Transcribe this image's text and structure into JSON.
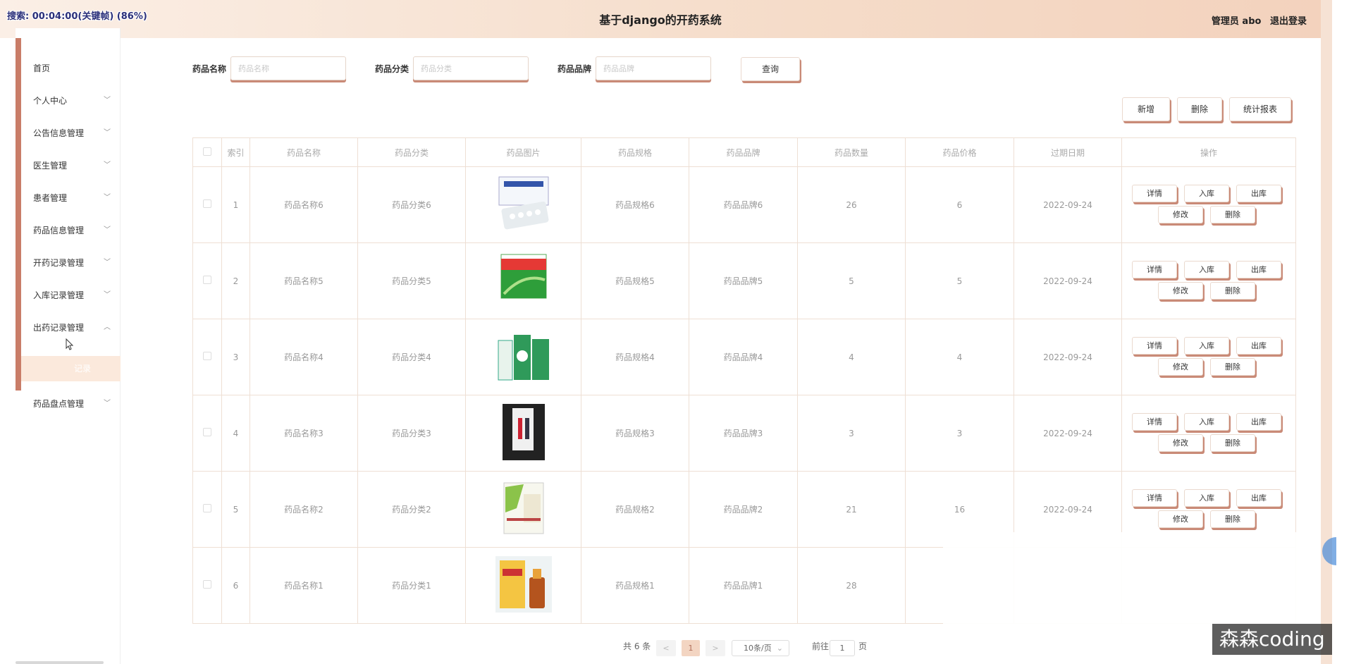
{
  "header": {
    "recording": "搜索: 00:04:00(关键帧) (86%)",
    "title": "基于django的开药系统",
    "user_label": "管理员 abo",
    "logout_label": "退出登录"
  },
  "sidebar": {
    "items": [
      {
        "label": "首页",
        "chevron": ""
      },
      {
        "label": "个人中心",
        "chevron": "﹀"
      },
      {
        "label": "公告信息管理",
        "chevron": "﹀"
      },
      {
        "label": "医生管理",
        "chevron": "﹀"
      },
      {
        "label": "患者管理",
        "chevron": "﹀"
      },
      {
        "label": "药品信息管理",
        "chevron": "﹀"
      },
      {
        "label": "开药记录管理",
        "chevron": "﹀"
      },
      {
        "label": "入库记录管理",
        "chevron": "﹀"
      },
      {
        "label": "出药记录管理",
        "chevron": "︿"
      },
      {
        "label": "药品盘点管理",
        "chevron": "﹀"
      }
    ],
    "sub_item": "记录"
  },
  "search": {
    "name_label": "药品名称",
    "name_placeholder": "药品名称",
    "category_label": "药品分类",
    "category_placeholder": "药品分类",
    "brand_label": "药品品牌",
    "brand_placeholder": "药品品牌",
    "query_button": "查询"
  },
  "actions": {
    "add": "新增",
    "delete": "删除",
    "report": "统计报表"
  },
  "table": {
    "headers": [
      "",
      "索引",
      "药品名称",
      "药品分类",
      "药品图片",
      "药品规格",
      "药品品牌",
      "药品数量",
      "药品价格",
      "过期日期",
      "操作"
    ],
    "rows": [
      {
        "index": "1",
        "name": "药品名称6",
        "category": "药品分类6",
        "spec": "药品规格6",
        "brand": "药品品牌6",
        "qty": "26",
        "price": "6",
        "expiry": "2022-09-24"
      },
      {
        "index": "2",
        "name": "药品名称5",
        "category": "药品分类5",
        "spec": "药品规格5",
        "brand": "药品品牌5",
        "qty": "5",
        "price": "5",
        "expiry": "2022-09-24"
      },
      {
        "index": "3",
        "name": "药品名称4",
        "category": "药品分类4",
        "spec": "药品规格4",
        "brand": "药品品牌4",
        "qty": "4",
        "price": "4",
        "expiry": "2022-09-24"
      },
      {
        "index": "4",
        "name": "药品名称3",
        "category": "药品分类3",
        "spec": "药品规格3",
        "brand": "药品品牌3",
        "qty": "3",
        "price": "3",
        "expiry": "2022-09-24"
      },
      {
        "index": "5",
        "name": "药品名称2",
        "category": "药品分类2",
        "spec": "药品规格2",
        "brand": "药品品牌2",
        "qty": "21",
        "price": "16",
        "expiry": "2022-09-24"
      },
      {
        "index": "6",
        "name": "药品名称1",
        "category": "药品分类1",
        "spec": "药品规格1",
        "brand": "药品品牌1",
        "qty": "28",
        "price": "",
        "expiry": ""
      }
    ],
    "op_labels": {
      "detail": "详情",
      "stock_in": "入库",
      "stock_out": "出库",
      "edit": "修改",
      "delete": "删除"
    }
  },
  "pagination": {
    "total": "共 6 条",
    "prev": "<",
    "current": "1",
    "next": ">",
    "page_size": "10条/页",
    "goto_label": "前往",
    "goto_value": "1",
    "page_suffix": "页"
  },
  "watermark": "森森coding"
}
